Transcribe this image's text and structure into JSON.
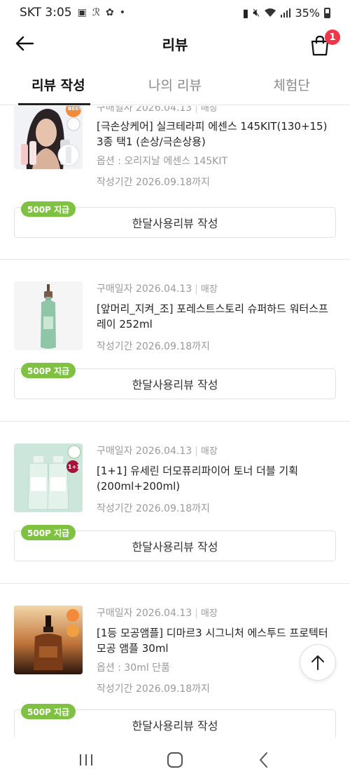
{
  "status_bar": {
    "carrier_time": "SKT 3:05",
    "battery": "35%"
  },
  "header": {
    "title": "리뷰",
    "cart_count": "1"
  },
  "tabs": [
    {
      "label": "리뷰 작성",
      "active": true
    },
    {
      "label": "나의 리뷰",
      "active": false
    },
    {
      "label": "체험단",
      "active": false
    }
  ],
  "items": [
    {
      "purchase_label": "구매일자 2026.04.13",
      "store": "매장",
      "name": "[극손상케어] 실크테라피 에센스 145KIT(130+15) 3종 택1 (손상/극손상용)",
      "option": "옵션 : 오리지날 에센스 145KIT",
      "period": "작성기간 2026.09.18까지",
      "point_badge": "500P 지급",
      "button": "한달사용리뷰 작성"
    },
    {
      "purchase_label": "구매일자 2026.04.13",
      "store": "매장",
      "name": "[앞머리_지켜_조] 포레스트스토리 슈퍼하드 워터스프레이 252ml",
      "option": "",
      "period": "작성기간 2026.09.18까지",
      "point_badge": "500P 지급",
      "button": "한달사용리뷰 작성"
    },
    {
      "purchase_label": "구매일자 2026.04.13",
      "store": "매장",
      "name": "[1+1] 유세린 더모퓨리파이어 토너 더블 기획 (200ml+200ml)",
      "option": "",
      "period": "작성기간 2026.09.18까지",
      "point_badge": "500P 지급",
      "button": "한달사용리뷰 작성"
    },
    {
      "purchase_label": "구매일자 2026.04.13",
      "store": "매장",
      "name": "[1등 모공앰플] 디마르3 시그니처 에스투드 프로텍터 모공 앰플 30ml",
      "option": "옵션 : 30ml 단품",
      "period": "작성기간 2026.09.18까지",
      "point_badge": "500P 지급",
      "button": "한달사용리뷰 작성"
    }
  ],
  "thumb_labels": {
    "item1_best": "BEST",
    "item3_badge": "1+1"
  },
  "colors": {
    "accent_green": "#7fc241",
    "badge_red": "#f2364a"
  }
}
